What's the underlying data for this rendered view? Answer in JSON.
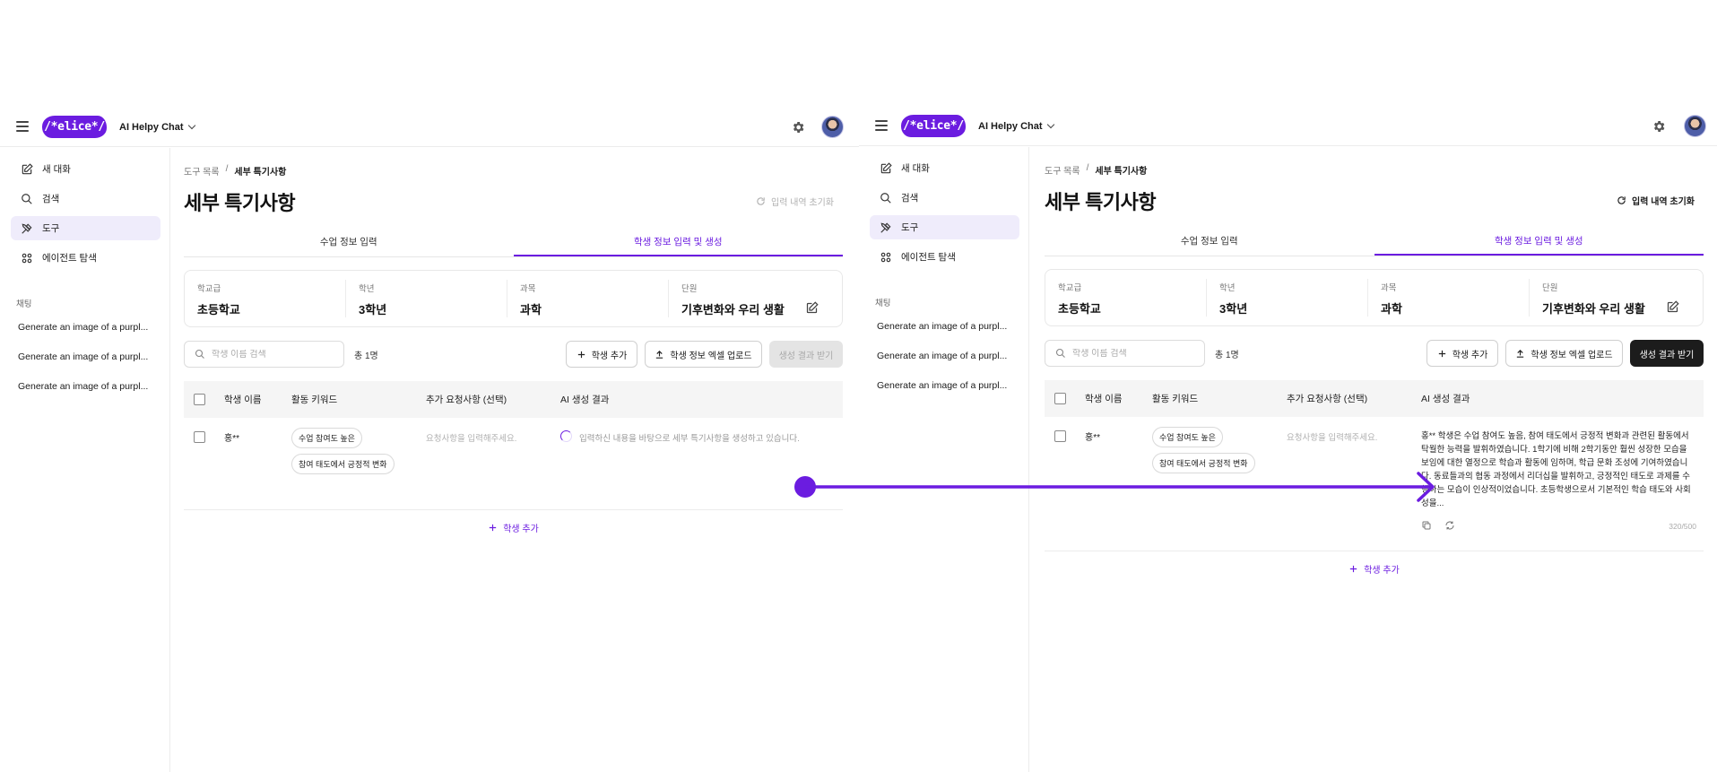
{
  "header": {
    "logo_text": "/*elice*/",
    "workspace": "AI Helpy Chat"
  },
  "sidebar": {
    "nav": [
      {
        "label": "새 대화",
        "icon": "edit-icon"
      },
      {
        "label": "검색",
        "icon": "search-icon"
      },
      {
        "label": "도구",
        "icon": "tools-icon",
        "active": true
      },
      {
        "label": "에이전트 탐색",
        "icon": "grid-icon"
      }
    ],
    "section_label": "채팅",
    "chats": [
      "Generate an image of a purpl...",
      "Generate an image of a purpl...",
      "Generate an image of a purpl..."
    ]
  },
  "breadcrumb": {
    "parent": "도구 목록",
    "separator": "/",
    "current": "세부 특기사항"
  },
  "page_title": "세부 특기사항",
  "reset_label": "입력 내역 초기화",
  "tabs": [
    "수업 정보 입력",
    "학생 정보 입력 및 생성"
  ],
  "info": {
    "fields": [
      {
        "label": "학교급",
        "value": "초등학교"
      },
      {
        "label": "학년",
        "value": "3학년"
      },
      {
        "label": "과목",
        "value": "과학"
      },
      {
        "label": "단원",
        "value": "기후변화와 우리 생활"
      }
    ]
  },
  "toolbar": {
    "search_placeholder": "학생 이름 검색",
    "count": "총 1명",
    "add_label": "학생 추가",
    "upload_label": "학생 정보 엑셀 업로드",
    "generate_label": "생성 결과 받기"
  },
  "table": {
    "headers": [
      "학생 이름",
      "활동 키워드",
      "추가 요청사항 (선택)",
      "AI 생성 결과"
    ],
    "row": {
      "name": "홍**",
      "keywords": [
        "수업 참여도 높은",
        "참여 태도에서 긍정적 변화"
      ],
      "request_placeholder": "요청사항을 입력해주세요."
    },
    "loading_text": "입력하신 내용을 바탕으로 세부 특기사항을 생성하고 있습니다.",
    "result_text": "홍** 학생은 수업 참여도 높음, 참여 태도에서 긍정적 변화과 관련된 활동에서 탁월한 능력을 발휘하였습니다. 1학기에 비해 2학기동안 훨씬 성장한 모습을 보임에 대한 열정으로 학습과 활동에 임하며, 학급 문화 조성에 기여하였습니다. 동료들과의 협동 과정에서 리더십을 발휘하고, 긍정적인 태도로 과제를 수행하는 모습이 인상적이었습니다. 초등학생으로서 기본적인 학습 태도와 사회성을...",
    "char_count": "320/500"
  },
  "add_student_label": "학생 추가",
  "colors": {
    "accent": "#6b1ce0",
    "active_nav_bg": "#efecfb",
    "dark_button": "#1c1c1c"
  }
}
